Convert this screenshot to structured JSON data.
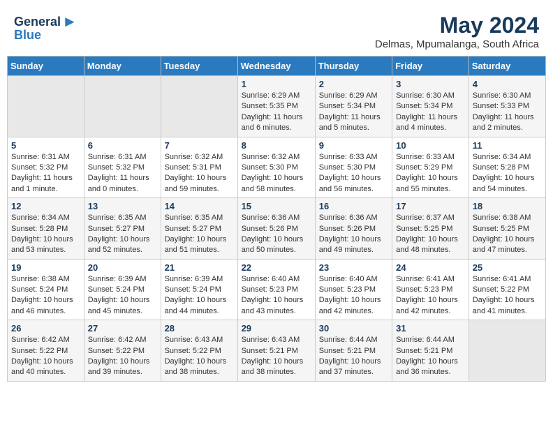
{
  "logo": {
    "general": "General",
    "blue": "Blue"
  },
  "title": {
    "month": "May 2024",
    "location": "Delmas, Mpumalanga, South Africa"
  },
  "headers": [
    "Sunday",
    "Monday",
    "Tuesday",
    "Wednesday",
    "Thursday",
    "Friday",
    "Saturday"
  ],
  "weeks": [
    [
      {
        "day": "",
        "info": ""
      },
      {
        "day": "",
        "info": ""
      },
      {
        "day": "",
        "info": ""
      },
      {
        "day": "1",
        "info": "Sunrise: 6:29 AM\nSunset: 5:35 PM\nDaylight: 11 hours and 6 minutes."
      },
      {
        "day": "2",
        "info": "Sunrise: 6:29 AM\nSunset: 5:34 PM\nDaylight: 11 hours and 5 minutes."
      },
      {
        "day": "3",
        "info": "Sunrise: 6:30 AM\nSunset: 5:34 PM\nDaylight: 11 hours and 4 minutes."
      },
      {
        "day": "4",
        "info": "Sunrise: 6:30 AM\nSunset: 5:33 PM\nDaylight: 11 hours and 2 minutes."
      }
    ],
    [
      {
        "day": "5",
        "info": "Sunrise: 6:31 AM\nSunset: 5:32 PM\nDaylight: 11 hours and 1 minute."
      },
      {
        "day": "6",
        "info": "Sunrise: 6:31 AM\nSunset: 5:32 PM\nDaylight: 11 hours and 0 minutes."
      },
      {
        "day": "7",
        "info": "Sunrise: 6:32 AM\nSunset: 5:31 PM\nDaylight: 10 hours and 59 minutes."
      },
      {
        "day": "8",
        "info": "Sunrise: 6:32 AM\nSunset: 5:30 PM\nDaylight: 10 hours and 58 minutes."
      },
      {
        "day": "9",
        "info": "Sunrise: 6:33 AM\nSunset: 5:30 PM\nDaylight: 10 hours and 56 minutes."
      },
      {
        "day": "10",
        "info": "Sunrise: 6:33 AM\nSunset: 5:29 PM\nDaylight: 10 hours and 55 minutes."
      },
      {
        "day": "11",
        "info": "Sunrise: 6:34 AM\nSunset: 5:28 PM\nDaylight: 10 hours and 54 minutes."
      }
    ],
    [
      {
        "day": "12",
        "info": "Sunrise: 6:34 AM\nSunset: 5:28 PM\nDaylight: 10 hours and 53 minutes."
      },
      {
        "day": "13",
        "info": "Sunrise: 6:35 AM\nSunset: 5:27 PM\nDaylight: 10 hours and 52 minutes."
      },
      {
        "day": "14",
        "info": "Sunrise: 6:35 AM\nSunset: 5:27 PM\nDaylight: 10 hours and 51 minutes."
      },
      {
        "day": "15",
        "info": "Sunrise: 6:36 AM\nSunset: 5:26 PM\nDaylight: 10 hours and 50 minutes."
      },
      {
        "day": "16",
        "info": "Sunrise: 6:36 AM\nSunset: 5:26 PM\nDaylight: 10 hours and 49 minutes."
      },
      {
        "day": "17",
        "info": "Sunrise: 6:37 AM\nSunset: 5:25 PM\nDaylight: 10 hours and 48 minutes."
      },
      {
        "day": "18",
        "info": "Sunrise: 6:38 AM\nSunset: 5:25 PM\nDaylight: 10 hours and 47 minutes."
      }
    ],
    [
      {
        "day": "19",
        "info": "Sunrise: 6:38 AM\nSunset: 5:24 PM\nDaylight: 10 hours and 46 minutes."
      },
      {
        "day": "20",
        "info": "Sunrise: 6:39 AM\nSunset: 5:24 PM\nDaylight: 10 hours and 45 minutes."
      },
      {
        "day": "21",
        "info": "Sunrise: 6:39 AM\nSunset: 5:24 PM\nDaylight: 10 hours and 44 minutes."
      },
      {
        "day": "22",
        "info": "Sunrise: 6:40 AM\nSunset: 5:23 PM\nDaylight: 10 hours and 43 minutes."
      },
      {
        "day": "23",
        "info": "Sunrise: 6:40 AM\nSunset: 5:23 PM\nDaylight: 10 hours and 42 minutes."
      },
      {
        "day": "24",
        "info": "Sunrise: 6:41 AM\nSunset: 5:23 PM\nDaylight: 10 hours and 42 minutes."
      },
      {
        "day": "25",
        "info": "Sunrise: 6:41 AM\nSunset: 5:22 PM\nDaylight: 10 hours and 41 minutes."
      }
    ],
    [
      {
        "day": "26",
        "info": "Sunrise: 6:42 AM\nSunset: 5:22 PM\nDaylight: 10 hours and 40 minutes."
      },
      {
        "day": "27",
        "info": "Sunrise: 6:42 AM\nSunset: 5:22 PM\nDaylight: 10 hours and 39 minutes."
      },
      {
        "day": "28",
        "info": "Sunrise: 6:43 AM\nSunset: 5:22 PM\nDaylight: 10 hours and 38 minutes."
      },
      {
        "day": "29",
        "info": "Sunrise: 6:43 AM\nSunset: 5:21 PM\nDaylight: 10 hours and 38 minutes."
      },
      {
        "day": "30",
        "info": "Sunrise: 6:44 AM\nSunset: 5:21 PM\nDaylight: 10 hours and 37 minutes."
      },
      {
        "day": "31",
        "info": "Sunrise: 6:44 AM\nSunset: 5:21 PM\nDaylight: 10 hours and 36 minutes."
      },
      {
        "day": "",
        "info": ""
      }
    ]
  ]
}
